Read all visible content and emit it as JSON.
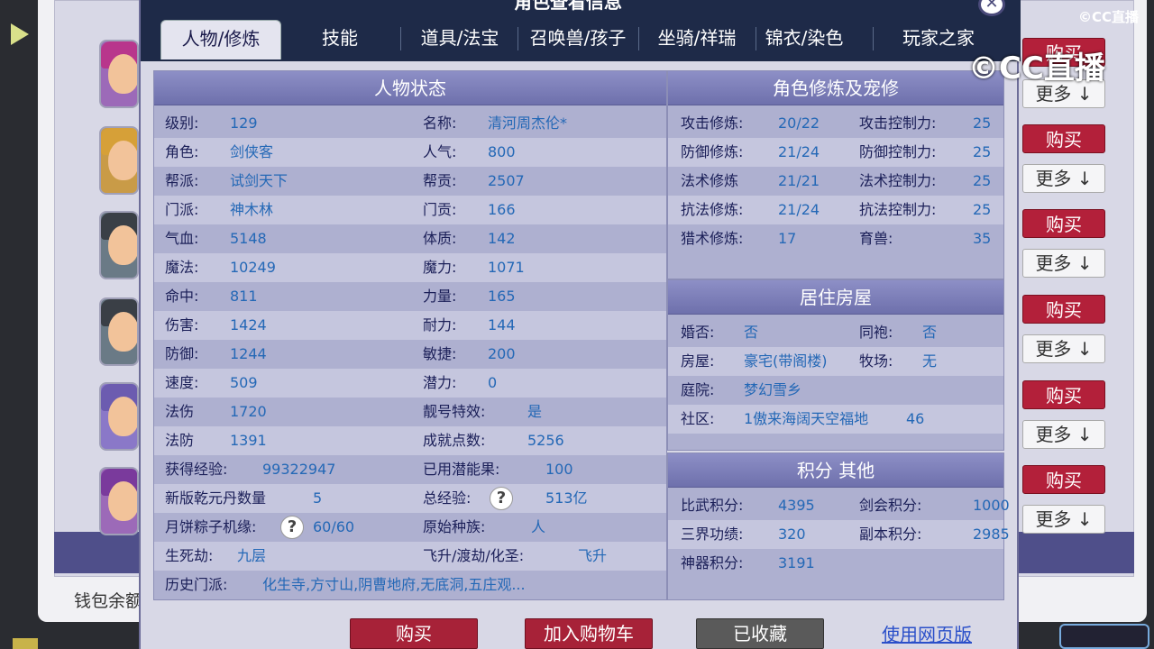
{
  "dialog": {
    "title": "角色查看信息",
    "close_glyph": "✕",
    "tabs": [
      {
        "label": "人物/修炼"
      },
      {
        "label": "技能"
      },
      {
        "label": "道具/法宝"
      },
      {
        "label": "召唤兽/孩子"
      },
      {
        "label": "坐骑/祥瑞"
      },
      {
        "label": "锦衣/染色"
      },
      {
        "label": "玩家之家"
      }
    ],
    "status": {
      "header": "人物状态",
      "rows": [
        {
          "l1": "级别:",
          "v1": "129",
          "l2": "名称:",
          "v2": "清河周杰伦*"
        },
        {
          "l1": "角色:",
          "v1": "剑侠客",
          "l2": "人气:",
          "v2": "800"
        },
        {
          "l1": "帮派:",
          "v1": "试剑天下",
          "l2": "帮贡:",
          "v2": "2507"
        },
        {
          "l1": "门派:",
          "v1": "神木林",
          "l2": "门贡:",
          "v2": "166"
        },
        {
          "l1": "气血:",
          "v1": "5148",
          "l2": "体质:",
          "v2": "142"
        },
        {
          "l1": "魔法:",
          "v1": "10249",
          "l2": "魔力:",
          "v2": "1071"
        },
        {
          "l1": "命中:",
          "v1": "811",
          "l2": "力量:",
          "v2": "165"
        },
        {
          "l1": "伤害:",
          "v1": "1424",
          "l2": "耐力:",
          "v2": "144"
        },
        {
          "l1": "防御:",
          "v1": "1244",
          "l2": "敏捷:",
          "v2": "200"
        },
        {
          "l1": "速度:",
          "v1": "509",
          "l2": "潜力:",
          "v2": "0"
        },
        {
          "l1": "法伤",
          "v1": "1720",
          "l2": "靓号特效:",
          "v2": "是"
        },
        {
          "l1": "法防",
          "v1": "1391",
          "l2": "成就点数:",
          "v2": "5256"
        },
        {
          "l1": "获得经验:",
          "v1": "99322947",
          "l2": "已用潜能果:",
          "v2": "100"
        },
        {
          "l1": "新版乾元丹数量",
          "v1": "5",
          "l2": "总经验:",
          "v2": "513亿"
        },
        {
          "l1": "月饼粽子机缘:",
          "v1": "60/60",
          "l2": "原始种族:",
          "v2": "人"
        },
        {
          "l1": "生死劫:",
          "v1": "九层",
          "l2": "飞升/渡劫/化圣:",
          "v2": "飞升"
        }
      ],
      "history_label": "历史门派:",
      "history_value": "化生寺,方寸山,阴曹地府,无底洞,五庄观..."
    },
    "cultivation": {
      "header": "角色修炼及宠修",
      "rows": [
        {
          "l1": "攻击修炼:",
          "v1": "20/22",
          "l2": "攻击控制力:",
          "v2": "25"
        },
        {
          "l1": "防御修炼:",
          "v1": "21/24",
          "l2": "防御控制力:",
          "v2": "25"
        },
        {
          "l1": "法术修炼",
          "v1": "21/21",
          "l2": "法术控制力:",
          "v2": "25"
        },
        {
          "l1": "抗法修炼:",
          "v1": "21/24",
          "l2": "抗法控制力:",
          "v2": "25"
        },
        {
          "l1": "猎术修炼:",
          "v1": "17",
          "l2": "育兽:",
          "v2": "35"
        }
      ]
    },
    "housing": {
      "header": "居住房屋",
      "rows": [
        {
          "l1": "婚否:",
          "v1": "否",
          "l2": "同袍:",
          "v2": "否"
        },
        {
          "l1": "房屋:",
          "v1": "豪宅(带阁楼)",
          "l2": "牧场:",
          "v2": "无"
        },
        {
          "l1": "庭院:",
          "v1": "梦幻雪乡",
          "l2": "",
          "v2": ""
        },
        {
          "l1": "社区:",
          "v1": "1傲来海阔天空福地",
          "l2": "",
          "v2": "46"
        }
      ]
    },
    "scores": {
      "header": "积分 其他",
      "rows": [
        {
          "l1": "比武积分:",
          "v1": "4395",
          "l2": "剑会积分:",
          "v2": "1000"
        },
        {
          "l1": "三界功绩:",
          "v1": "320",
          "l2": "副本积分:",
          "v2": "2985"
        },
        {
          "l1": "神器积分:",
          "v1": "3191",
          "l2": "",
          "v2": ""
        }
      ]
    },
    "buttons": {
      "buy": "购买",
      "add_cart": "加入购物车",
      "favorited": "已收藏",
      "web_version": "使用网页版"
    },
    "help_glyph": "?"
  },
  "background": {
    "wallet_label": "钱包余额",
    "buy_label": "购买",
    "more_label": "更多 ↓",
    "logo_small": "©CC直播",
    "logo_big": "©CC直播"
  },
  "colors": {
    "header_bg": "#1e2a48",
    "buy_red": "#b3203a",
    "value_blue": "#2468b6",
    "label_navy": "#1b1f58"
  }
}
